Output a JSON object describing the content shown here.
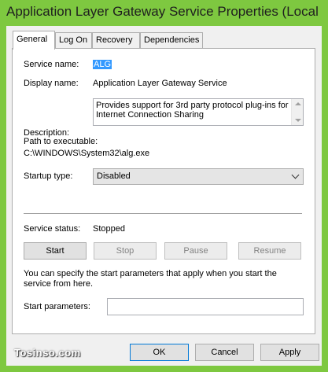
{
  "window": {
    "title": "Application Layer Gateway Service Properties (Local C..."
  },
  "tabs": [
    {
      "label": "General",
      "active": true
    },
    {
      "label": "Log On",
      "active": false
    },
    {
      "label": "Recovery",
      "active": false
    },
    {
      "label": "Dependencies",
      "active": false
    }
  ],
  "general": {
    "service_name_label": "Service name:",
    "service_name_value": "ALG",
    "display_name_label": "Display name:",
    "display_name_value": "Application Layer Gateway Service",
    "description_label": "Description:",
    "description_value": "Provides support for 3rd party protocol plug-ins for Internet Connection Sharing",
    "path_label": "Path to executable:",
    "path_value": "C:\\WINDOWS\\System32\\alg.exe",
    "startup_type_label": "Startup type:",
    "startup_type_value": "Disabled",
    "service_status_label": "Service status:",
    "service_status_value": "Stopped",
    "buttons": {
      "start": "Start",
      "stop": "Stop",
      "pause": "Pause",
      "resume": "Resume"
    },
    "start_params_help": "You can specify the start parameters that apply when you start the service from here.",
    "start_params_label": "Start parameters:",
    "start_params_value": ""
  },
  "dialog_buttons": {
    "ok": "OK",
    "cancel": "Cancel",
    "apply": "Apply"
  },
  "watermark": "Tosinso.com"
}
